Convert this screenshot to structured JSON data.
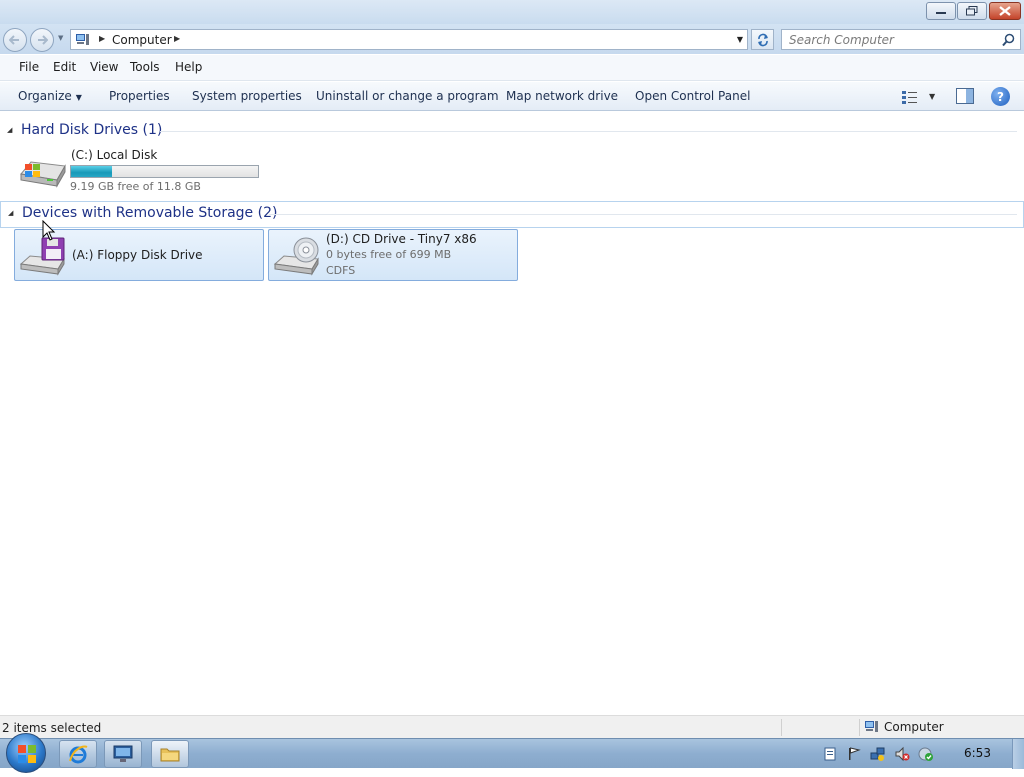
{
  "window": {
    "minimize_icon": "minimize-icon",
    "maximize_icon": "restore-icon",
    "close_icon": "close-icon"
  },
  "address": {
    "crumb": "Computer",
    "search_placeholder": "Search Computer"
  },
  "menu": {
    "items": [
      "File",
      "Edit",
      "View",
      "Tools",
      "Help"
    ]
  },
  "commands": {
    "organize": "Organize",
    "properties": "Properties",
    "system_properties": "System properties",
    "uninstall": "Uninstall or change a program",
    "map_drive": "Map network drive",
    "control_panel": "Open Control Panel",
    "help_glyph": "?"
  },
  "groups": {
    "hard_disks": {
      "title": "Hard Disk Drives (1)",
      "drives": [
        {
          "name": "(C:) Local Disk",
          "free_text": "9.19 GB free of 11.8 GB",
          "used_fraction": 0.22
        }
      ]
    },
    "removable": {
      "title": "Devices with Removable Storage (2)",
      "drives": [
        {
          "name": "(A:) Floppy Disk Drive"
        },
        {
          "name": "(D:) CD Drive - Tiny7 x86",
          "free_text": "0 bytes free of 699 MB",
          "filesystem": "CDFS"
        }
      ]
    }
  },
  "status": {
    "selection": "2 items selected",
    "location": "Computer"
  },
  "taskbar": {
    "clock": "6:53"
  },
  "colors": {
    "group_title": "#1e3287",
    "selection_border": "#84acdd",
    "drive_bar": "#1899b8"
  }
}
